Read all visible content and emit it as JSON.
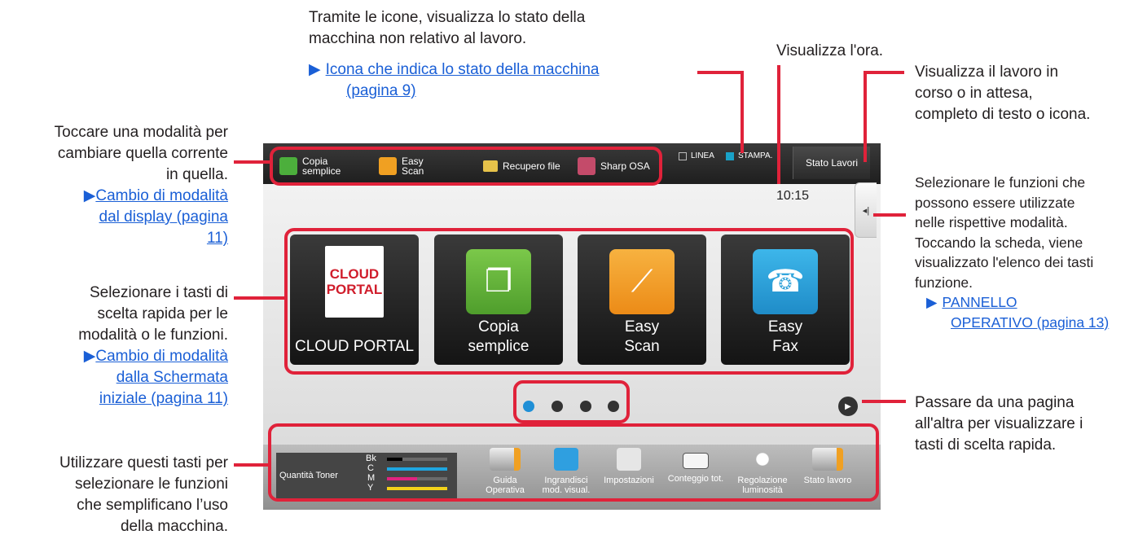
{
  "annotations": {
    "top_icons": {
      "line1": "Tramite le icone, visualizza lo stato della",
      "line2": "macchina non relativo al lavoro.",
      "link1": "Icona che indica lo stato della macchina",
      "link2": "(pagina 9)"
    },
    "clock": {
      "text": "Visualizza l'ora."
    },
    "job": {
      "line1": "Visualizza il lavoro in",
      "line2": "corso o in attesa,",
      "line3": "completo di testo o icona."
    },
    "mode_switch": {
      "line1": "Toccare una modalità per",
      "line2": "cambiare quella corrente",
      "line3": "in quella.",
      "link1": "Cambio di modalità",
      "link2": "dal display (pagina",
      "link3": "11)"
    },
    "shortcuts": {
      "line1": "Selezionare i tasti di",
      "line2": "scelta rapida per le",
      "line3": "modalità o le funzioni.",
      "link1": "Cambio di modalità",
      "link2": "dalla Schermata",
      "link3": "iniziale (pagina 11)"
    },
    "bottom_keys": {
      "line1": "Utilizzare questi tasti per",
      "line2": "selezionare le funzioni",
      "line3": "che semplificano l’uso",
      "line4": "della macchina."
    },
    "side_tab": {
      "line1": "Selezionare le funzioni che",
      "line2": "possono essere utilizzate",
      "line3": "nelle rispettive modalità.",
      "line4": "Toccando la scheda, viene",
      "line5": "visualizzato l'elenco dei tasti",
      "line6": "funzione.",
      "link1": "PANNELLO",
      "link2": "OPERATIVO (pagina 13)"
    },
    "paging": {
      "line1": "Passare da una pagina",
      "line2": "all'altra per visualizzare i",
      "line3": "tasti di scelta rapida."
    }
  },
  "screen": {
    "top_modes": [
      {
        "line1": "Copia",
        "line2": "semplice"
      },
      {
        "line1": "Easy",
        "line2": "Scan"
      },
      {
        "line1": "Recupero file"
      },
      {
        "line1": "Sharp OSA"
      }
    ],
    "lamps": {
      "line": "LINEA",
      "print": "STAMPA."
    },
    "job_status": "Stato Lavori",
    "clock": "10:15",
    "tiles": [
      {
        "line1": "CLOUD PORTAL",
        "line2": "",
        "logo": "CLOUD PORTAL"
      },
      {
        "line1": "Copia",
        "line2": "semplice"
      },
      {
        "line1": "Easy",
        "line2": "Scan"
      },
      {
        "line1": "Easy",
        "line2": "Fax"
      }
    ],
    "toner": {
      "label": "Quantità Toner",
      "bk": "Bk",
      "c": "C",
      "m": "M",
      "y": "Y",
      "levels": {
        "bk": 0.25,
        "c": 1.0,
        "m": 0.5,
        "y": 1.0
      }
    },
    "function_keys": [
      {
        "line1": "Guida",
        "line2": "Operativa"
      },
      {
        "line1": "Ingrandisci",
        "line2": "mod. visual."
      },
      {
        "line1": "Impostazioni",
        "line2": ""
      },
      {
        "line1": "Conteggio tot.",
        "line2": ""
      },
      {
        "line1": "Regolazione",
        "line2": "luminosità"
      },
      {
        "line1": "Stato lavoro",
        "line2": ""
      }
    ],
    "pager": {
      "pages": 4,
      "current": 1
    }
  },
  "colors": {
    "accent_red": "#e0223a",
    "link_blue": "#1a5fd6",
    "print_lamp": "#19a2c8"
  }
}
